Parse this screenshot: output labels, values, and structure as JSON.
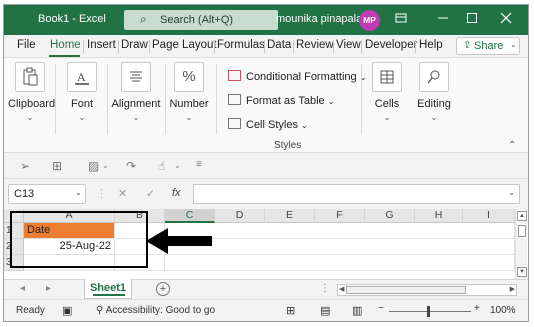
{
  "title_bar": {
    "workbook_title": "Book1  -  Excel",
    "search_label": "Search (Alt+Q)",
    "user_name": "mounika pinapala",
    "user_initials": "MP",
    "colors": {
      "bar": "#217346",
      "avatar": "#c239b3"
    }
  },
  "ribbon_tabs": {
    "items": [
      {
        "label": "File"
      },
      {
        "label": "Home"
      },
      {
        "label": "Insert"
      },
      {
        "label": "Draw"
      },
      {
        "label": "Page Layout"
      },
      {
        "label": "Formulas"
      },
      {
        "label": "Data"
      },
      {
        "label": "Review"
      },
      {
        "label": "View"
      },
      {
        "label": "Developer"
      },
      {
        "label": "Help"
      }
    ],
    "active": "Home",
    "share_label": "Share"
  },
  "ribbon": {
    "clipboard": "Clipboard",
    "font": "Font",
    "alignment": "Alignment",
    "number": "Number",
    "conditional_formatting": "Conditional Formatting",
    "format_as_table": "Format as Table",
    "cell_styles": "Cell Styles",
    "styles_group": "Styles",
    "cells": "Cells",
    "editing": "Editing",
    "number_icon": "%"
  },
  "formula_bar": {
    "name_box": "C13",
    "fx_label": "fx",
    "formula": ""
  },
  "grid": {
    "columns": [
      "A",
      "B",
      "C",
      "D",
      "E",
      "F",
      "G",
      "H",
      "I"
    ],
    "selected_column": "C",
    "rows": [
      "1",
      "2",
      "3"
    ],
    "cells": {
      "A1": "Date",
      "A2": "25-Aug-22"
    },
    "header_fill": "#ed7d31"
  },
  "sheets": {
    "tabs": [
      {
        "label": "Sheet1"
      }
    ],
    "active": "Sheet1"
  },
  "status_bar": {
    "ready": "Ready",
    "accessibility": "Accessibility: Good to go",
    "zoom": "100%"
  }
}
